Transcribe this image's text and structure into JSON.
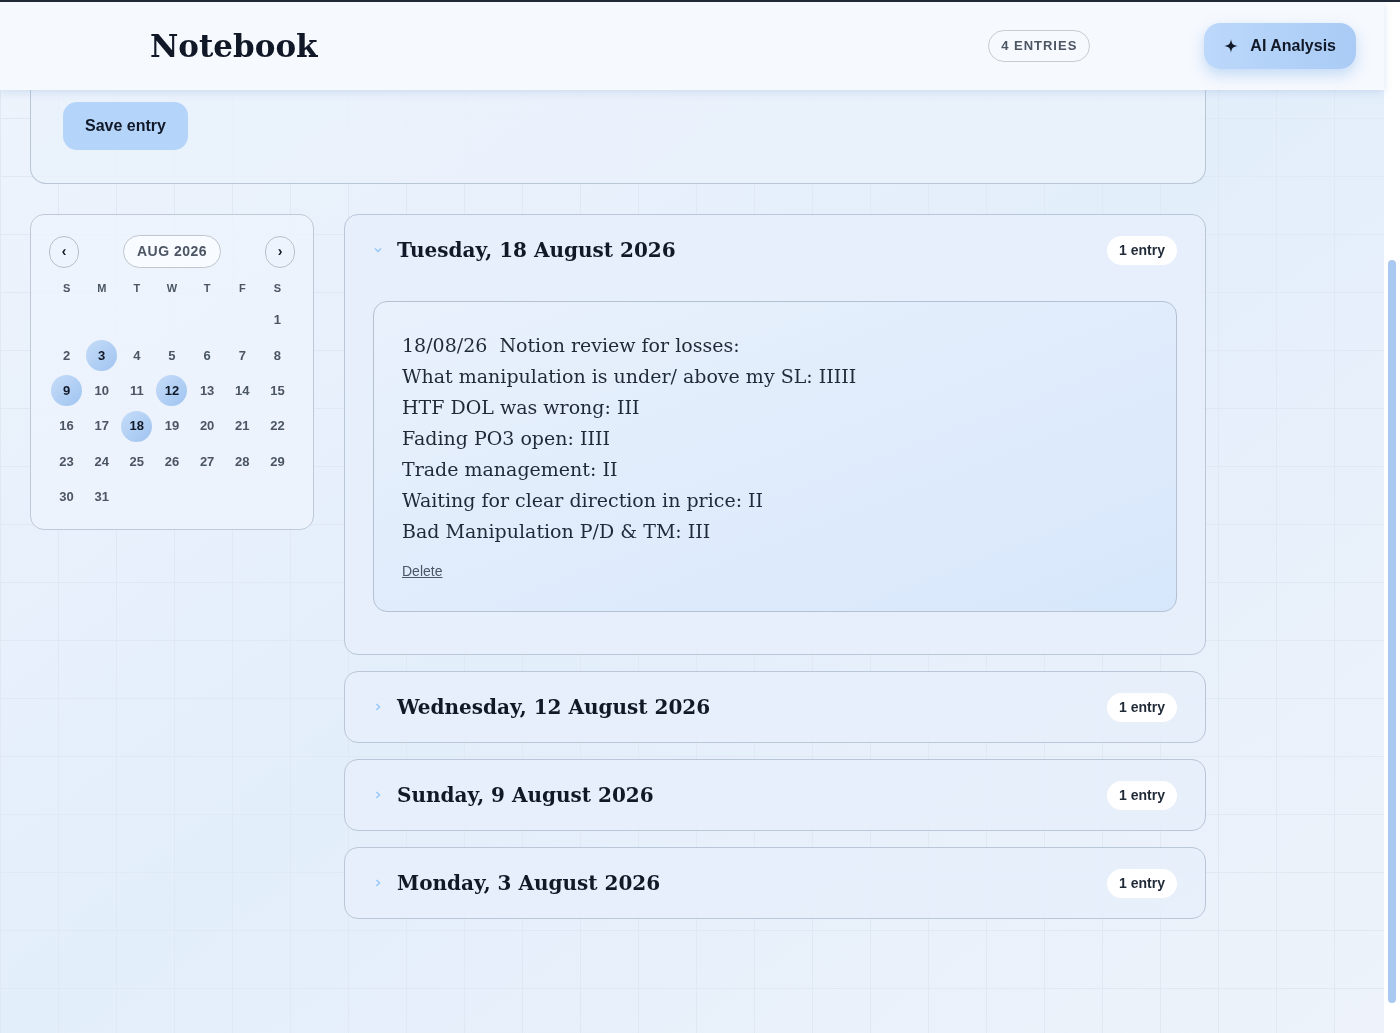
{
  "header": {
    "title": "Notebook",
    "entry_count": "4 ENTRIES",
    "ai_button": "AI Analysis"
  },
  "composer": {
    "save_button": "Save entry"
  },
  "calendar": {
    "month": "AUG 2026",
    "prev": "‹",
    "next": "›",
    "weekdays": [
      "S",
      "M",
      "T",
      "W",
      "T",
      "F",
      "S"
    ],
    "weeks": [
      [
        {
          "label": "1",
          "marked": false
        }
      ],
      [
        {
          "label": "2",
          "marked": false
        },
        {
          "label": "3",
          "marked": true
        },
        {
          "label": "4",
          "marked": false
        },
        {
          "label": "5",
          "marked": false
        },
        {
          "label": "6",
          "marked": false
        },
        {
          "label": "7",
          "marked": false
        },
        {
          "label": "8",
          "marked": false
        }
      ],
      [
        {
          "label": "9",
          "marked": true
        },
        {
          "label": "10",
          "marked": false
        },
        {
          "label": "11",
          "marked": false
        },
        {
          "label": "12",
          "marked": true
        },
        {
          "label": "13",
          "marked": false
        },
        {
          "label": "14",
          "marked": false
        },
        {
          "label": "15",
          "marked": false
        }
      ],
      [
        {
          "label": "16",
          "marked": false
        },
        {
          "label": "17",
          "marked": false
        },
        {
          "label": "18",
          "marked": true
        },
        {
          "label": "19",
          "marked": false
        },
        {
          "label": "20",
          "marked": false
        },
        {
          "label": "21",
          "marked": false
        },
        {
          "label": "22",
          "marked": false
        }
      ],
      [
        {
          "label": "23",
          "marked": false
        },
        {
          "label": "24",
          "marked": false
        },
        {
          "label": "25",
          "marked": false
        },
        {
          "label": "26",
          "marked": false
        },
        {
          "label": "27",
          "marked": false
        },
        {
          "label": "28",
          "marked": false
        },
        {
          "label": "29",
          "marked": false
        }
      ],
      [
        {
          "label": "30",
          "marked": false
        },
        {
          "label": "31",
          "marked": false
        }
      ]
    ]
  },
  "days": [
    {
      "title": "Tuesday, 18 August 2026",
      "count": "1 entry",
      "expanded": true,
      "notes": [
        {
          "lines": [
            "18/08/26  Notion review for losses:",
            "What manipulation is under/ above my SL: IIIII",
            "HTF DOL was wrong: III",
            "Fading PO3 open: IIII",
            "Trade management: II",
            "Waiting for clear direction in price: II",
            "Bad Manipulation P/D & TM: III"
          ],
          "delete": "Delete"
        }
      ]
    },
    {
      "title": "Wednesday, 12 August 2026",
      "count": "1 entry",
      "expanded": false
    },
    {
      "title": "Sunday, 9 August 2026",
      "count": "1 entry",
      "expanded": false
    },
    {
      "title": "Monday, 3 August 2026",
      "count": "1 entry",
      "expanded": false
    }
  ]
}
